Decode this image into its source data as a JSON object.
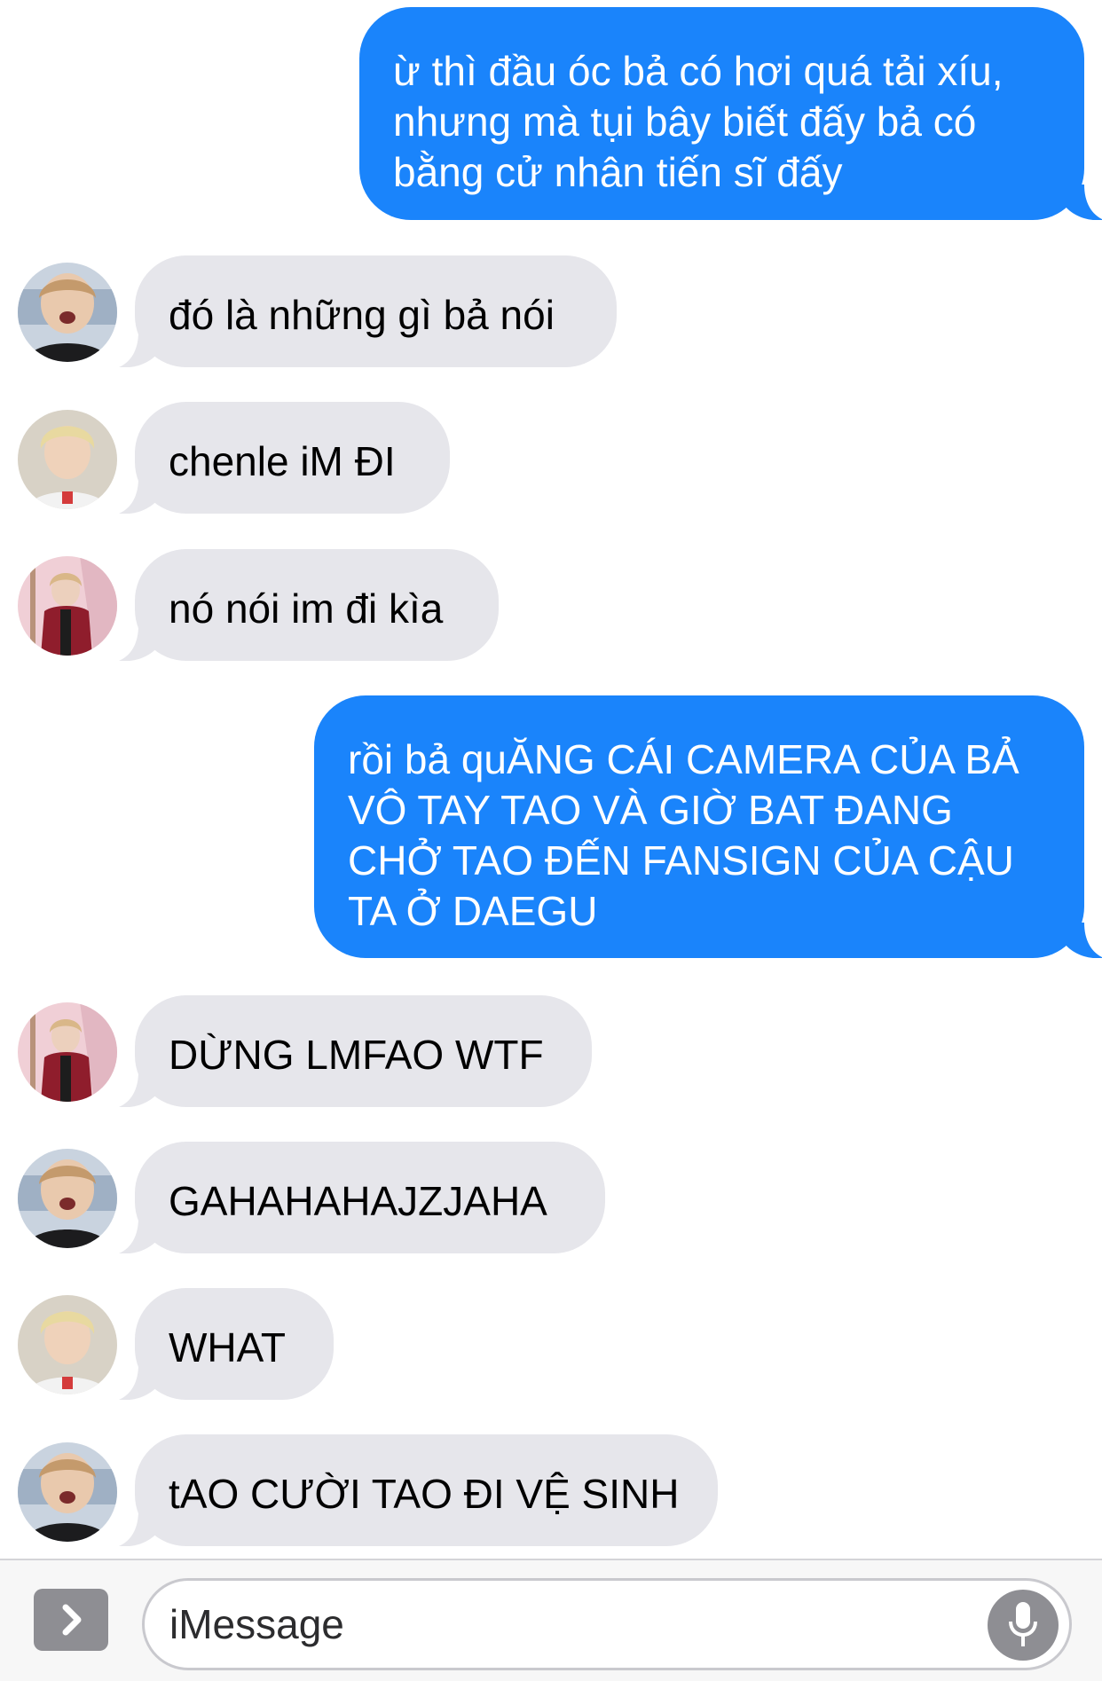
{
  "conversation": {
    "messages": [
      {
        "direction": "outgoing",
        "text": "ừ thì đầu óc bả có hơi quá tải xíu,\nnhưng mà tụi bây biết đấy bả có\nbằng cử nhân tiến sĩ đấy"
      },
      {
        "direction": "incoming",
        "sender_avatar": "avatar-a",
        "text": "đó là những gì bả nói"
      },
      {
        "direction": "incoming",
        "sender_avatar": "avatar-b",
        "text": "chenle iM ĐI"
      },
      {
        "direction": "incoming",
        "sender_avatar": "avatar-c",
        "text": "nó nói im đi kìa"
      },
      {
        "direction": "outgoing",
        "text": "rồi bả quĂNG CÁI CAMERA CỦA BẢ\nVÔ TAY TAO VÀ GIỜ BAT ĐANG\nCHỞ TAO ĐẾN FANSIGN CỦA CẬU\nTA Ở DAEGU"
      },
      {
        "direction": "incoming",
        "sender_avatar": "avatar-c",
        "text": "DỪNG LMFAO WTF"
      },
      {
        "direction": "incoming",
        "sender_avatar": "avatar-a",
        "text": "GAHAHAHAJZJAHA"
      },
      {
        "direction": "incoming",
        "sender_avatar": "avatar-b",
        "text": "WHAT"
      },
      {
        "direction": "incoming",
        "sender_avatar": "avatar-a",
        "text": "tAO CƯỜI TAO ĐI VỆ SINH"
      }
    ]
  },
  "input_bar": {
    "apps_icon": "chevron-right-icon",
    "placeholder": "iMessage",
    "mic_icon": "microphone-icon"
  },
  "colors": {
    "outgoing_bubble": "#1a84fb",
    "incoming_bubble": "#e6e6eb",
    "outgoing_text": "#ffffff",
    "incoming_text": "#000000"
  }
}
